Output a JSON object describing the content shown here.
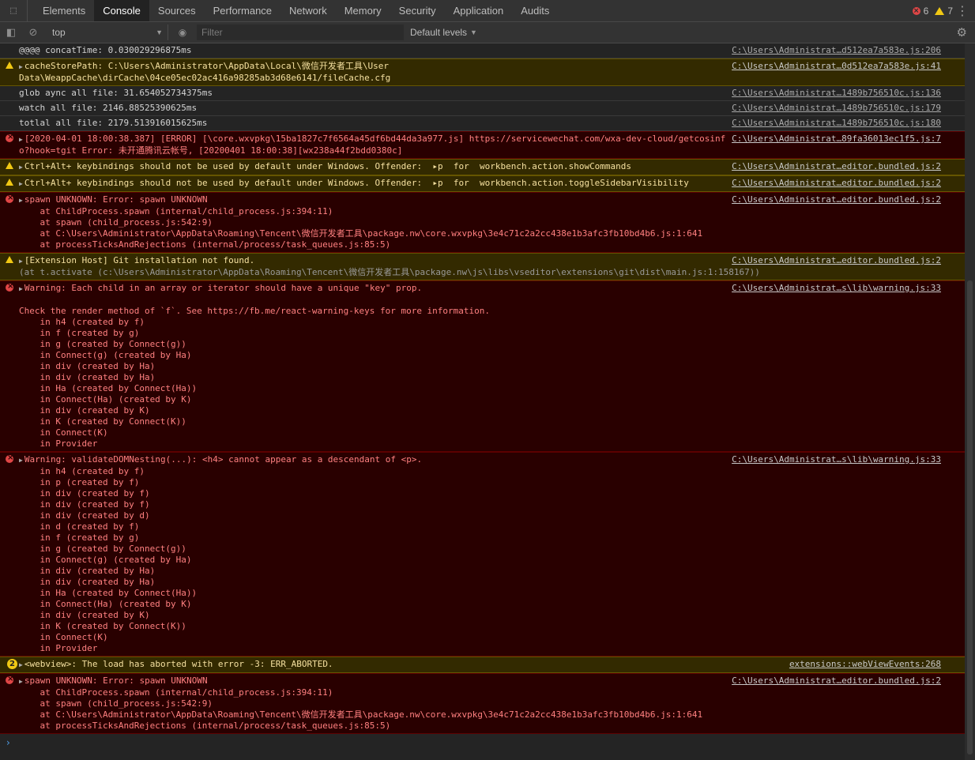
{
  "tabs": [
    "Elements",
    "Console",
    "Sources",
    "Performance",
    "Network",
    "Memory",
    "Security",
    "Application",
    "Audits"
  ],
  "counts": {
    "errors": "6",
    "warnings": "7"
  },
  "toolbar": {
    "context": "top",
    "filter_placeholder": "Filter",
    "levels": "Default levels"
  },
  "messages": [
    {
      "level": "log",
      "lines": [
        "@@@@ concatTime: 0.030029296875ms"
      ],
      "src": "C:\\Users\\Administrat…d512ea7a583e.js:206"
    },
    {
      "level": "warn",
      "lines": [
        "cacheStorePath: C:\\Users\\Administrator\\AppData\\Local\\微信开发者工具\\User",
        "Data\\WeappCache\\dirCache\\04ce05ec02ac416a98285ab3d68e6141/fileCache.cfg"
      ],
      "src": "C:\\Users\\Administrat…0d512ea7a583e.js:41"
    },
    {
      "level": "log",
      "lines": [
        "glob aync all file: 31.654052734375ms"
      ],
      "src": "C:\\Users\\Administrat…1489b756510c.js:136"
    },
    {
      "level": "log",
      "lines": [
        "watch all file: 2146.88525390625ms"
      ],
      "src": "C:\\Users\\Administrat…1489b756510c.js:179"
    },
    {
      "level": "log",
      "lines": [
        "totlal all file: 2179.513916015625ms"
      ],
      "src": "C:\\Users\\Administrat…1489b756510c.js:180"
    },
    {
      "level": "error",
      "lines": [
        "[2020-04-01 18:00:38.387] [ERROR] [\\core.wxvpkg\\15ba1827c7f6564a45df6bd44da3a977.js] https://servicewechat.com/wxa-dev-cloud/getcosinf",
        "o?hook=tgit Error: 未开通腾讯云帐号, [20200401 18:00:38][wx238a44f2bdd0380c]"
      ],
      "src": "C:\\Users\\Administrat…89fa36013ec1f5.js:7"
    },
    {
      "level": "warn",
      "lines": [
        "Ctrl+Alt+ keybindings should not be used by default under Windows. Offender:  ▸p  for  workbench.action.showCommands"
      ],
      "src": "C:\\Users\\Administrat…editor.bundled.js:2"
    },
    {
      "level": "warn",
      "lines": [
        "Ctrl+Alt+ keybindings should not be used by default under Windows. Offender:  ▸p  for  workbench.action.toggleSidebarVisibility"
      ],
      "src": "C:\\Users\\Administrat…editor.bundled.js:2"
    },
    {
      "level": "error",
      "lines": [
        "spawn UNKNOWN: Error: spawn UNKNOWN",
        "    at ChildProcess.spawn (internal/child_process.js:394:11)",
        "    at spawn (child_process.js:542:9)",
        "    at C:\\Users\\Administrator\\AppData\\Roaming\\Tencent\\微信开发者工具\\package.nw\\core.wxvpkg\\3e4c71c2a2cc438e1b3afc3fb10bd4b6.js:1:641",
        "    at processTicksAndRejections (internal/process/task_queues.js:85:5)"
      ],
      "src": "C:\\Users\\Administrat…editor.bundled.js:2"
    },
    {
      "level": "warn",
      "lines": [
        "[Extension Host] Git installation not found.",
        "(at t.activate (c:\\Users\\Administrator\\AppData\\Roaming\\Tencent\\微信开发者工具\\package.nw\\js\\libs\\vseditor\\extensions\\git\\dist\\main.js:1:158167))"
      ],
      "src": "C:\\Users\\Administrat…editor.bundled.js:2"
    },
    {
      "level": "error",
      "lines": [
        "Warning: Each child in an array or iterator should have a unique \"key\" prop.",
        "",
        "Check the render method of `f`. See https://fb.me/react-warning-keys for more information.",
        "    in h4 (created by f)",
        "    in f (created by g)",
        "    in g (created by Connect(g))",
        "    in Connect(g) (created by Ha)",
        "    in div (created by Ha)",
        "    in div (created by Ha)",
        "    in Ha (created by Connect(Ha))",
        "    in Connect(Ha) (created by K)",
        "    in div (created by K)",
        "    in K (created by Connect(K))",
        "    in Connect(K)",
        "    in Provider"
      ],
      "src": "C:\\Users\\Administrat…s\\lib\\warning.js:33"
    },
    {
      "level": "error",
      "lines": [
        "Warning: validateDOMNesting(...): <h4> cannot appear as a descendant of <p>.",
        "    in h4 (created by f)",
        "    in p (created by f)",
        "    in div (created by f)",
        "    in div (created by f)",
        "    in div (created by d)",
        "    in d (created by f)",
        "    in f (created by g)",
        "    in g (created by Connect(g))",
        "    in Connect(g) (created by Ha)",
        "    in div (created by Ha)",
        "    in div (created by Ha)",
        "    in Ha (created by Connect(Ha))",
        "    in Connect(Ha) (created by K)",
        "    in div (created by K)",
        "    in K (created by Connect(K))",
        "    in Connect(K)",
        "    in Provider"
      ],
      "src": "C:\\Users\\Administrat…s\\lib\\warning.js:33"
    },
    {
      "level": "warn",
      "badge": "2",
      "lines": [
        "<webview>: The load has aborted with error -3: ERR_ABORTED."
      ],
      "src": "extensions::webViewEvents:268"
    },
    {
      "level": "error",
      "lines": [
        "spawn UNKNOWN: Error: spawn UNKNOWN",
        "    at ChildProcess.spawn (internal/child_process.js:394:11)",
        "    at spawn (child_process.js:542:9)",
        "    at C:\\Users\\Administrator\\AppData\\Roaming\\Tencent\\微信开发者工具\\package.nw\\core.wxvpkg\\3e4c71c2a2cc438e1b3afc3fb10bd4b6.js:1:641",
        "    at processTicksAndRejections (internal/process/task_queues.js:85:5)"
      ],
      "src": "C:\\Users\\Administrat…editor.bundled.js:2"
    }
  ],
  "prompt_glyph": "›"
}
